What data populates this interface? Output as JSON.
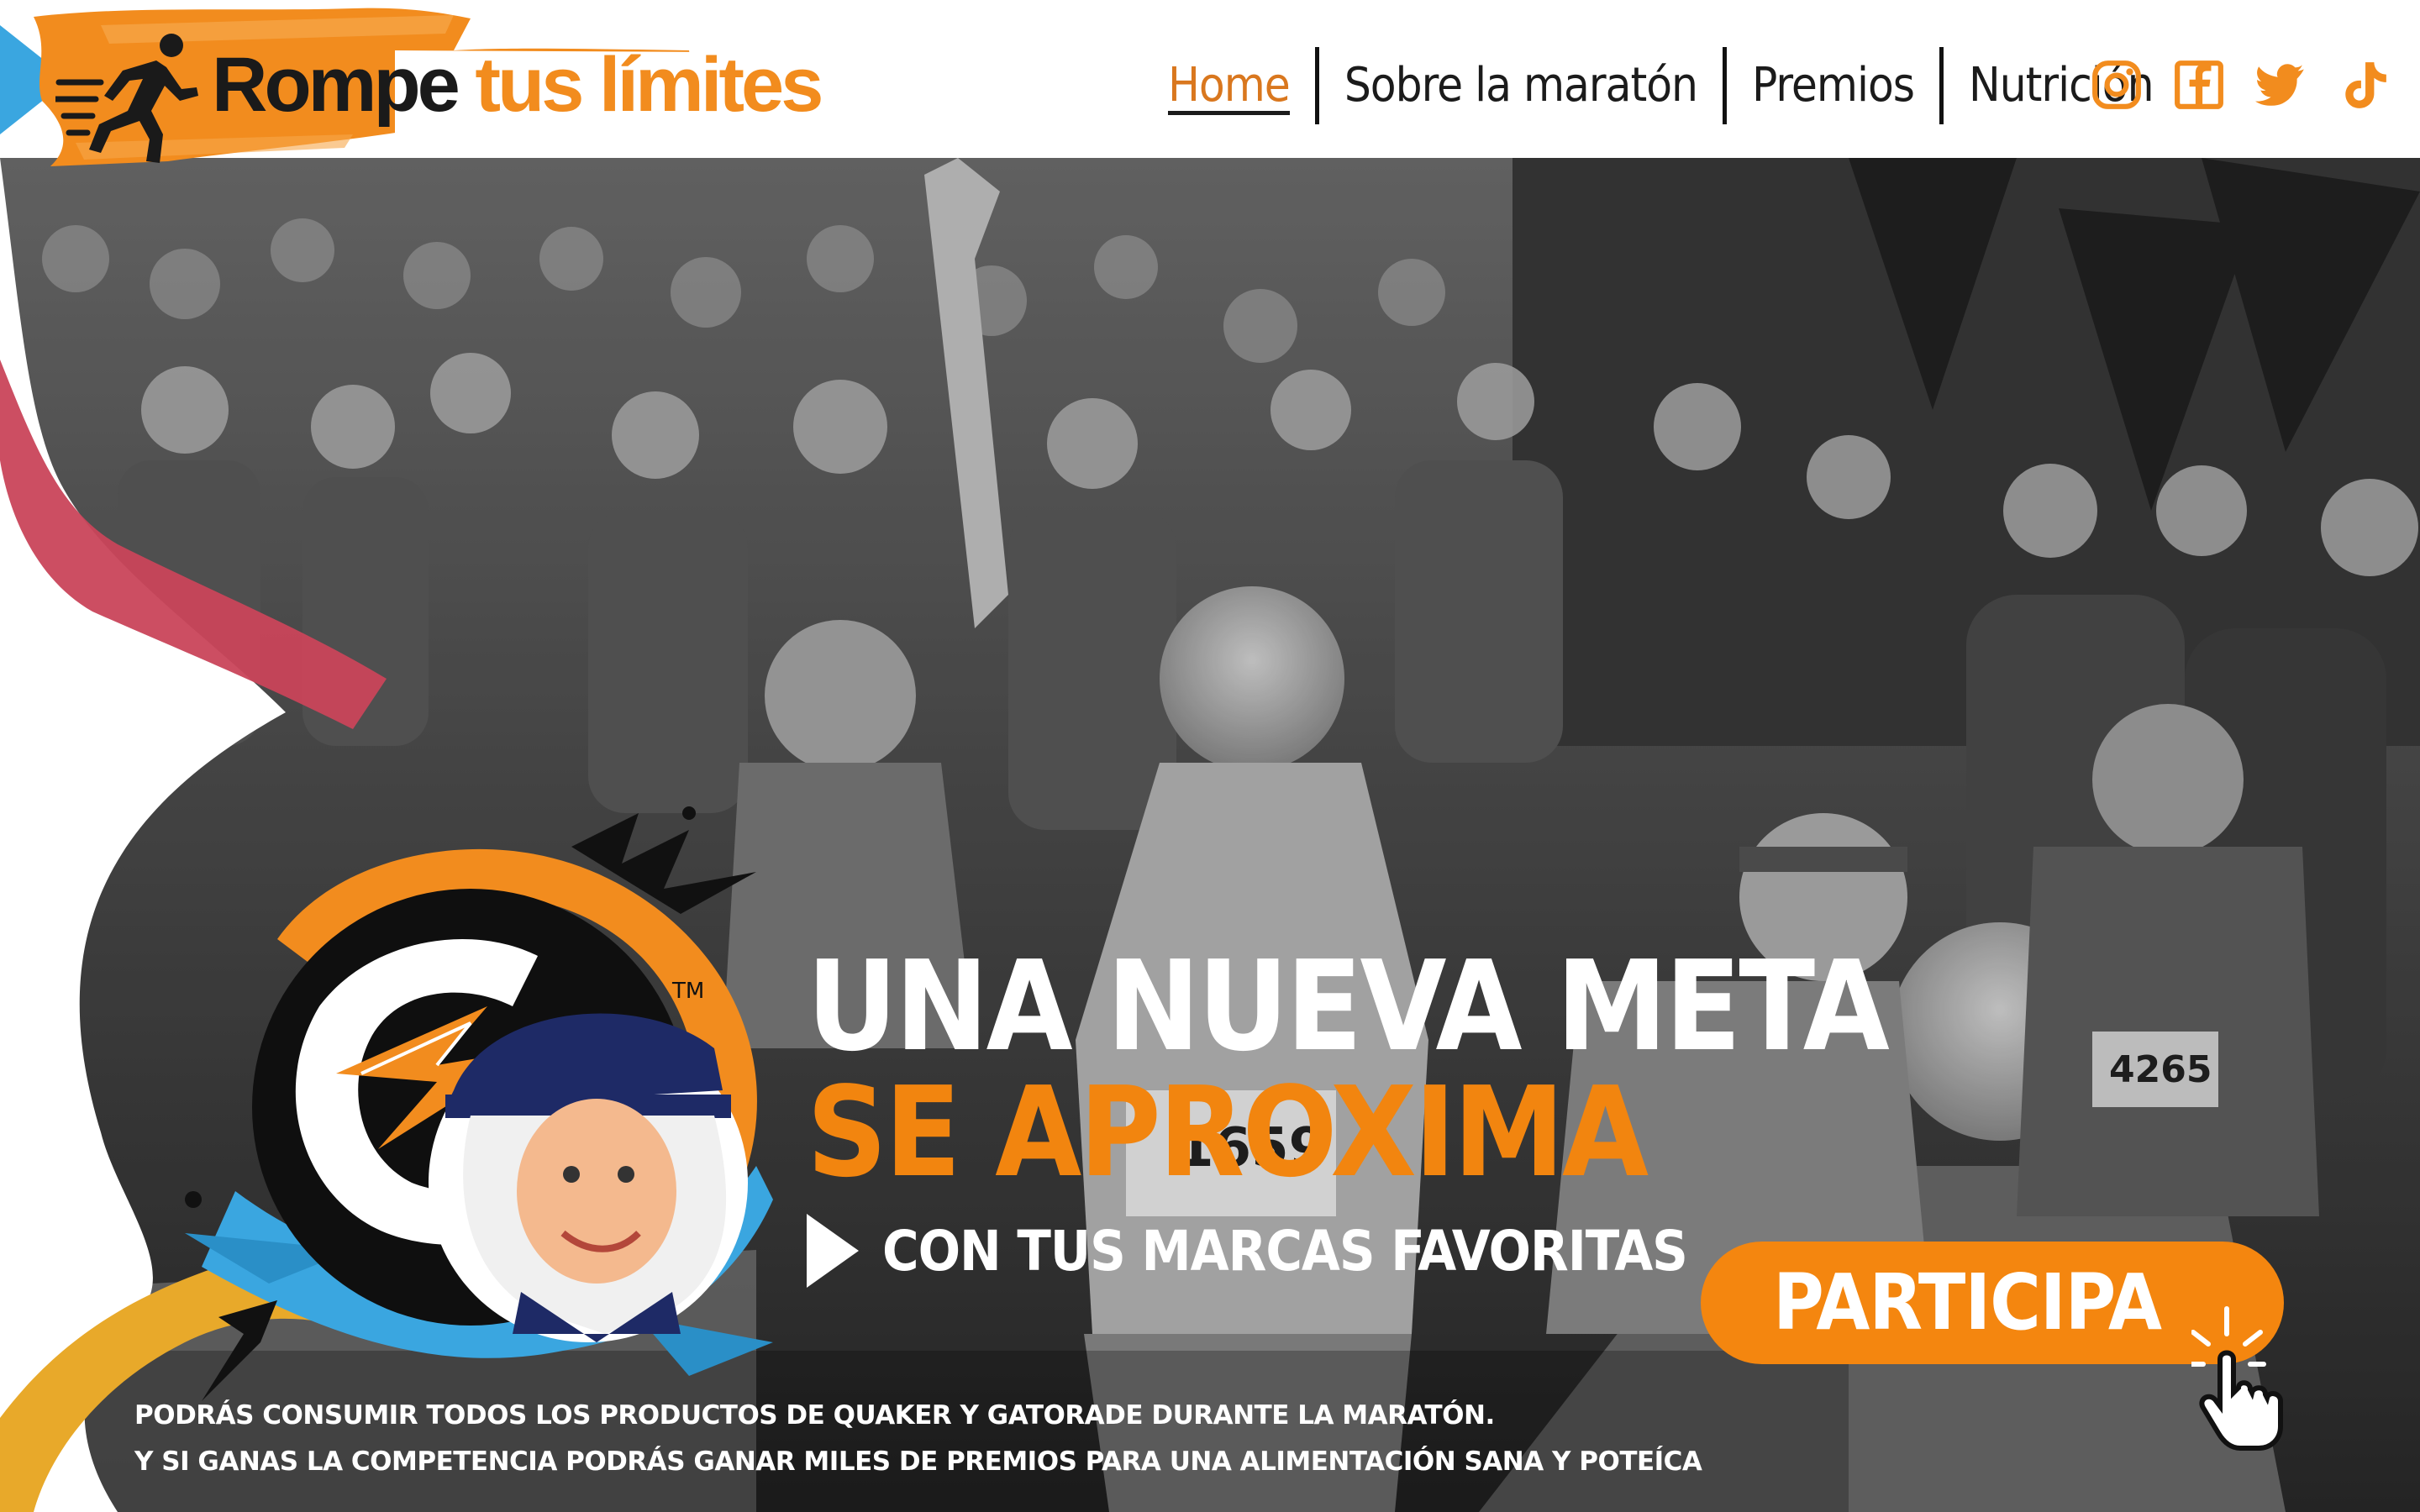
{
  "brand": {
    "name_part1": "Rompe",
    "name_part2": "tus límites",
    "logo_icon": "runner-icon",
    "colors": {
      "orange": "#f28c1e",
      "blue": "#3aa6e0",
      "dark": "#1a1a1a"
    }
  },
  "nav": {
    "items": [
      {
        "label": "Home",
        "active": true
      },
      {
        "label": "Sobre la maratón",
        "active": false
      },
      {
        "label": "Premios",
        "active": false
      },
      {
        "label": "Nutrición",
        "active": false
      }
    ],
    "socials": [
      "instagram-icon",
      "facebook-icon",
      "twitter-icon",
      "tiktok-icon"
    ],
    "social_color": "#f28c1e"
  },
  "hero": {
    "headline_line1": "UNA NUEVA META",
    "headline_line2": "SE APROXIMA",
    "subline": "CON TUS MARCAS FAVORITAS",
    "cta_label": "PARTICIPA",
    "cta_color": "#f4860f",
    "footer_line1": "PODRÁS CONSUMIR TODOS LOS PRODUCTOS DE QUAKER Y GATORADE DURANTE LA MARATÓN.",
    "footer_line2": "Y SI GANAS LA COMPETENCIA PODRÁS GANAR MILES DE PREMIOS PARA UNA ALIMENTACIÓN SANA Y POTEÍCA",
    "background": "black-and-white marathon runners photo",
    "sponsor_logos": [
      "gatorade-g-logo",
      "quaker-oats-logo"
    ]
  }
}
